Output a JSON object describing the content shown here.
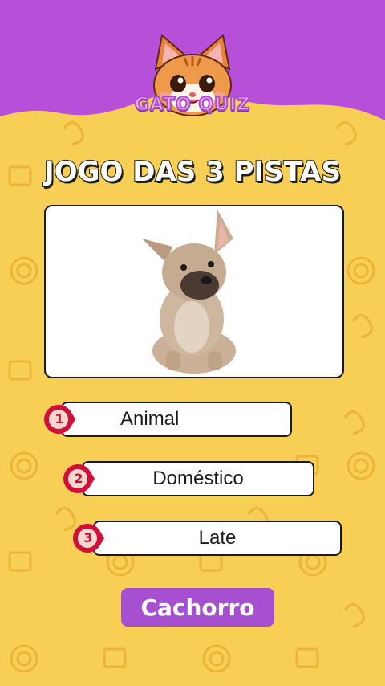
{
  "app": {
    "logo_text": "GATO QUIZ"
  },
  "game": {
    "title": "JOGO DAS 3 PISTAS",
    "image_subject": "french-bulldog-photo",
    "clues": [
      {
        "number": "1",
        "text": "Animal"
      },
      {
        "number": "2",
        "text": "Doméstico"
      },
      {
        "number": "3",
        "text": "Late"
      }
    ],
    "answer": "Cachorro"
  },
  "colors": {
    "background": "#f7cf55",
    "header_purple": "#b84fd8",
    "badge_red": "#d0103a",
    "answer_purple": "#a64fd1"
  }
}
